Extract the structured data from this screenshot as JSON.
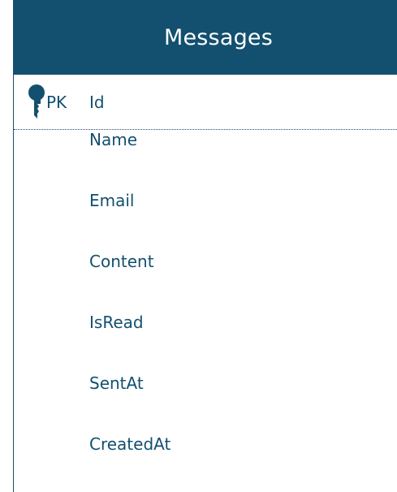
{
  "entity": {
    "title": "Messages",
    "primary_key": {
      "badge": "PK",
      "name": "Id",
      "icon": "key-icon"
    },
    "fields": [
      "Name",
      "Email",
      "Content",
      "IsRead",
      "SentAt",
      "CreatedAt"
    ]
  },
  "colors": {
    "header_bg": "#13506f",
    "header_text": "#ffffff",
    "field_text": "#13506f"
  }
}
